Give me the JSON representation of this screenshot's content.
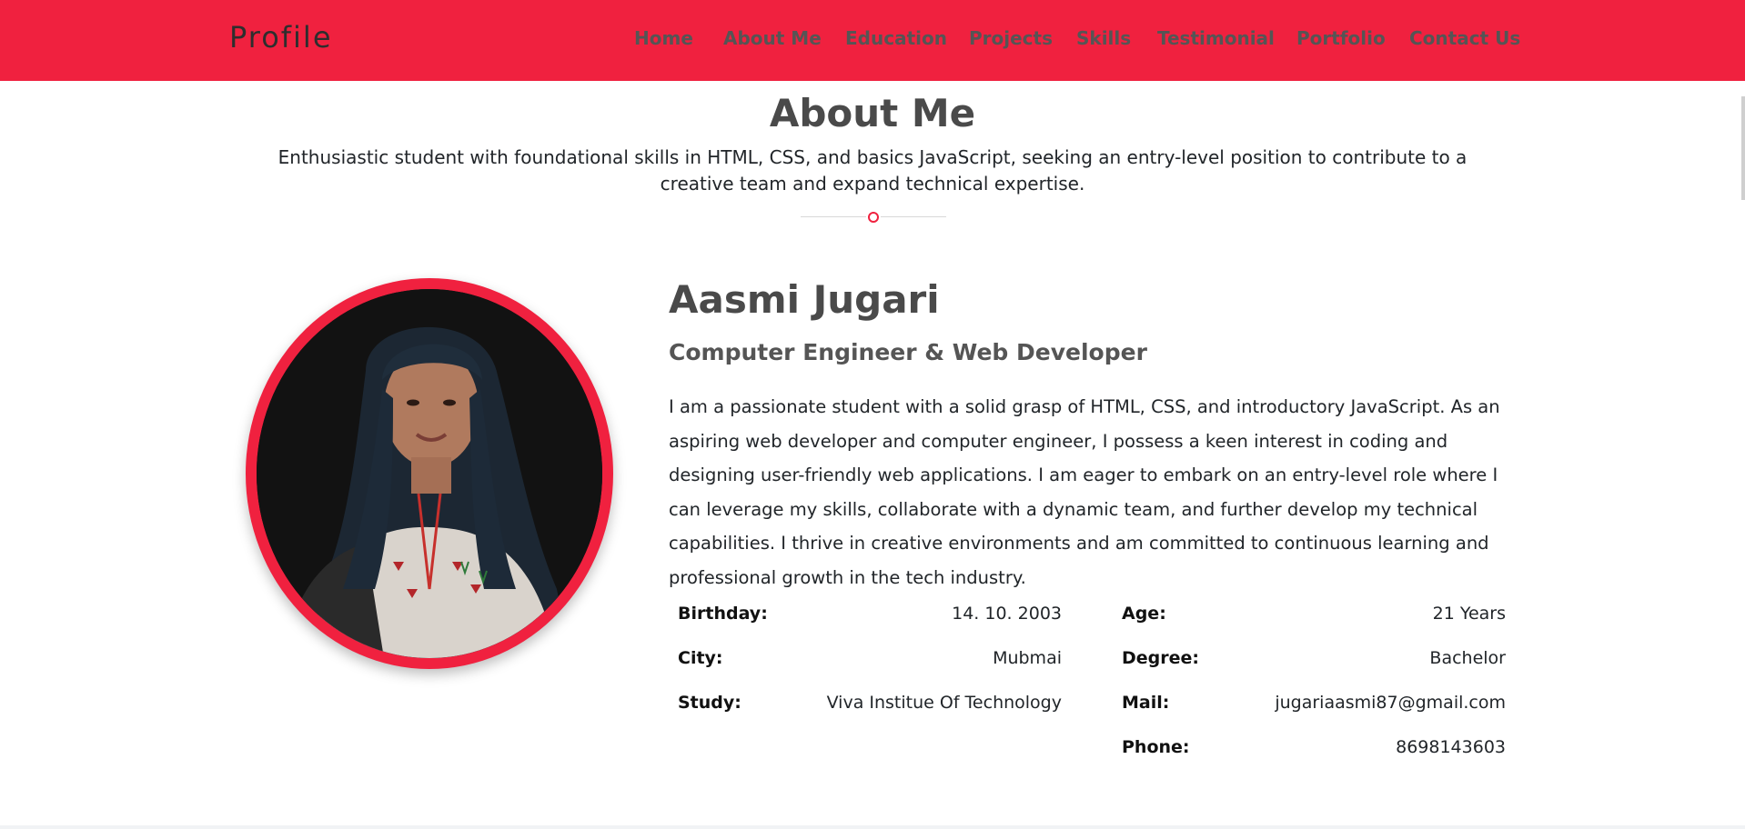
{
  "navbar": {
    "brand": "Profile",
    "links": [
      "Home",
      "About Me",
      "Education",
      "Projects",
      "Skills",
      "Testimonial",
      "Portfolio",
      "Contact Us"
    ]
  },
  "about": {
    "title": "About Me",
    "subtitle": "Enthusiastic student with foundational skills in HTML, CSS, and basics JavaScript, seeking an entry-level position to contribute to a creative team and expand technical expertise."
  },
  "profile": {
    "name": "Aasmi Jugari",
    "role": "Computer Engineer & Web Developer",
    "bio": "I am a passionate student with a solid grasp of HTML, CSS, and introductory JavaScript. As an aspiring web developer and computer engineer, I possess a keen interest in coding and designing user-friendly web applications. I am eager to embark on an entry-level role where I can leverage my skills, collaborate with a dynamic team, and further develop my technical capabilities. I thrive in creative environments and am committed to continuous learning and professional growth in the tech industry."
  },
  "info_left": [
    {
      "label": "Birthday:",
      "value": "14. 10. 2003"
    },
    {
      "label": "City:",
      "value": "Mubmai"
    },
    {
      "label": "Study:",
      "value": "Viva Institue Of Technology"
    }
  ],
  "info_right": [
    {
      "label": "Age:",
      "value": "21 Years"
    },
    {
      "label": "Degree:",
      "value": "Bachelor"
    },
    {
      "label": "Mail:",
      "value": "jugariaasmi87@gmail.com"
    },
    {
      "label": "Phone:",
      "value": "8698143603"
    }
  ],
  "colors": {
    "accent": "#f0213f",
    "heading": "#4a4a4a",
    "text": "#212529"
  }
}
